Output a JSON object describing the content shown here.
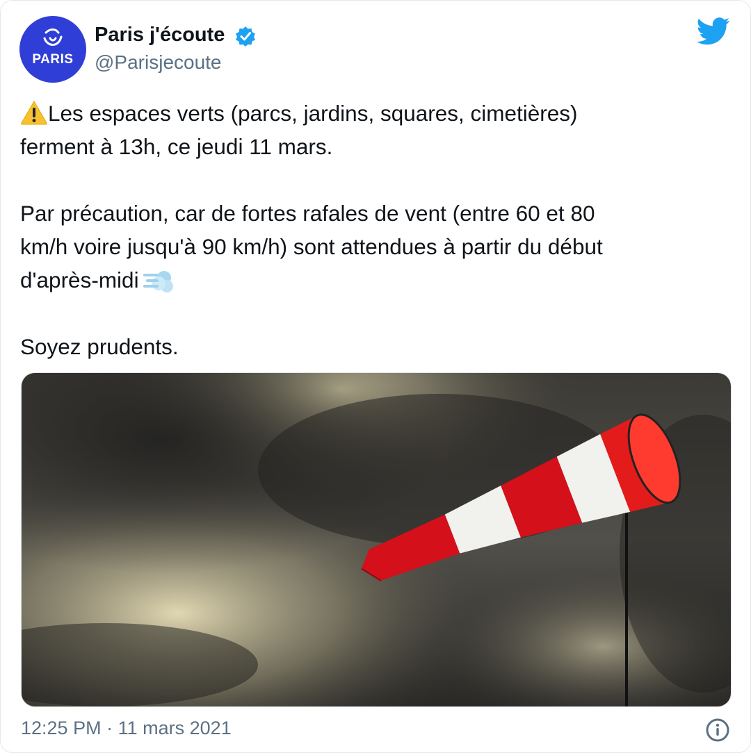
{
  "tweet": {
    "author": {
      "name": "Paris j'écoute",
      "handle": "@Parisjecoute",
      "avatar_text": "PARIS",
      "verified": true
    },
    "text": {
      "line1": "Les espaces verts (parcs, jardins, squares, cimetières)",
      "line2": "ferment à 13h, ce jeudi 11 mars.",
      "p2_line1": "Par précaution, car de fortes rafales de vent (entre 60 et 80",
      "p2_line2": "km/h voire jusqu'à 90 km/h) sont attendues à partir du début",
      "p2_line3": "d'après-midi",
      "p3": "Soyez prudents."
    },
    "media": {
      "subject": "windsock-in-stormy-sky"
    },
    "footer": {
      "time": "12:25 PM",
      "separator": "·",
      "date": "11 mars 2021"
    }
  },
  "colors": {
    "avatar_bg": "#2f3ed6",
    "twitter_blue": "#1da1f2",
    "text_primary": "#0f1419",
    "text_secondary": "#5b7083",
    "windsock_red": "#e31b1b"
  },
  "icons": {
    "warning": "warning-icon",
    "dash": "dashing-away-icon",
    "verified": "verified-badge-icon",
    "brand": "twitter-bird-icon",
    "info": "info-icon"
  }
}
